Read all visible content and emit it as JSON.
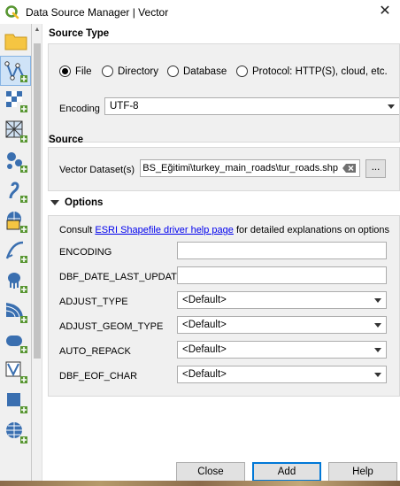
{
  "window": {
    "title": "Data Source Manager | Vector",
    "close_glyph": "✕"
  },
  "sidebar": {
    "items": [
      {
        "name": "browser",
        "icon": "folder-icon"
      },
      {
        "name": "vector",
        "icon": "add-vector-layer-icon",
        "active": true
      },
      {
        "name": "raster",
        "icon": "add-raster-layer-icon"
      },
      {
        "name": "mesh",
        "icon": "add-mesh-layer-icon"
      },
      {
        "name": "delimited-text",
        "icon": "add-delimited-text-icon"
      },
      {
        "name": "geopackage",
        "icon": "add-geopackage-icon"
      },
      {
        "name": "spatialite",
        "icon": "add-spatialite-icon"
      },
      {
        "name": "postgis",
        "icon": "add-postgis-icon"
      },
      {
        "name": "mssql",
        "icon": "add-mssql-icon"
      },
      {
        "name": "oracle",
        "icon": "add-oracle-icon"
      },
      {
        "name": "db2",
        "icon": "add-db2-icon"
      },
      {
        "name": "virtual-layer",
        "icon": "add-virtual-layer-icon"
      },
      {
        "name": "wms",
        "icon": "add-wms-icon"
      },
      {
        "name": "wfs",
        "icon": "add-wfs-icon"
      }
    ]
  },
  "source_type": {
    "heading": "Source Type",
    "options": [
      "File",
      "Directory",
      "Database",
      "Protocol: HTTP(S), cloud, etc."
    ],
    "selected": "File",
    "encoding_label": "Encoding",
    "encoding_value": "UTF-8"
  },
  "source": {
    "heading": "Source",
    "dataset_label": "Vector Dataset(s)",
    "dataset_value": "BS_Eğitimi\\turkey_main_roads\\tur_roads.shp",
    "browse_label": "..."
  },
  "options": {
    "heading": "Options",
    "consult_prefix": "Consult ",
    "consult_link": "ESRI Shapefile driver help page",
    "consult_suffix": " for detailed explanations on options",
    "rows": [
      {
        "label": "ENCODING",
        "kind": "text",
        "value": ""
      },
      {
        "label": "DBF_DATE_LAST_UPDATE",
        "kind": "text",
        "value": ""
      },
      {
        "label": "ADJUST_TYPE",
        "kind": "combo",
        "value": "<Default>"
      },
      {
        "label": "ADJUST_GEOM_TYPE",
        "kind": "combo",
        "value": "<Default>"
      },
      {
        "label": "AUTO_REPACK",
        "kind": "combo",
        "value": "<Default>"
      },
      {
        "label": "DBF_EOF_CHAR",
        "kind": "combo",
        "value": "<Default>"
      }
    ]
  },
  "buttons": {
    "close": "Close",
    "add": "Add",
    "help": "Help"
  },
  "colors": {
    "accent": "#0078d7",
    "link": "#0000ee",
    "qgis_green": "#589632"
  }
}
